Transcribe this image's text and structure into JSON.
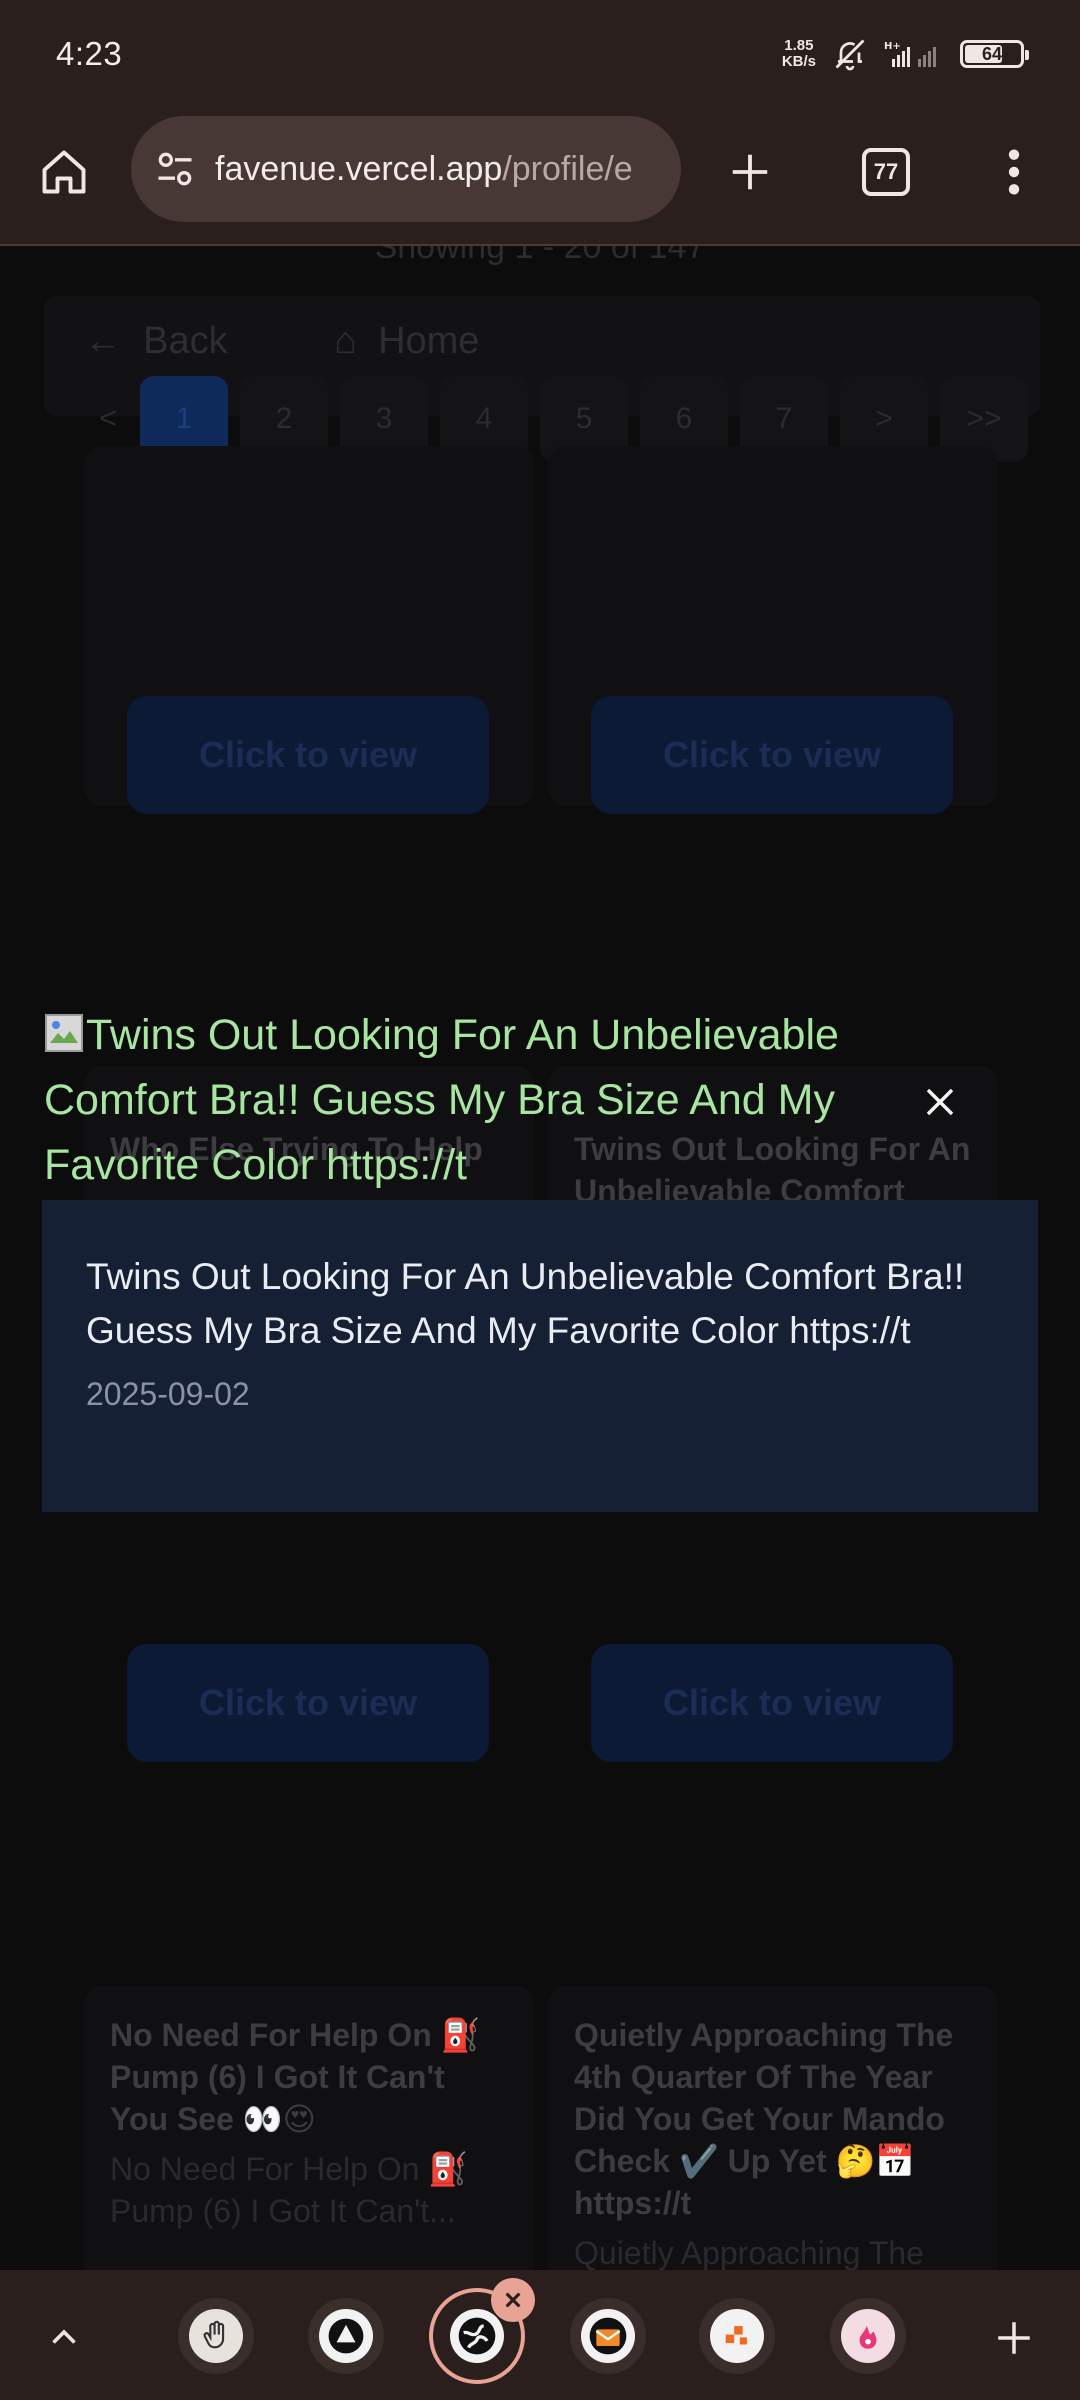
{
  "status_bar": {
    "time": "4:23",
    "net_speed_value": "1.85",
    "net_speed_unit": "KB/s",
    "battery": "64"
  },
  "browser": {
    "url_host": "favenue.vercel.app",
    "url_path": "/profile/e",
    "tab_count": "77"
  },
  "background_page": {
    "showing": "Showing 1 - 20 of 147",
    "back_label": "Back",
    "home_label": "Home",
    "pages": [
      "<",
      "1",
      "2",
      "3",
      "4",
      "5",
      "6",
      "7",
      ">",
      ">>"
    ],
    "view_button_label": "Click to view",
    "cards": [
      {
        "title": "No Need For Help On ⛽ Pump (6) I Got It Can't You See 👀😍",
        "subtitle": "No Need For Help On ⛽ Pump (6) I Got It Can't..."
      },
      {
        "title": "Quietly Approaching The 4th Quarter Of The Year Did You Get Your Mando Check ✔️ Up Yet 🤔📅 https://t",
        "subtitle": "Quietly Approaching The"
      }
    ],
    "mid_cards": [
      {
        "title": "Who Else Trying To Help"
      },
      {
        "title": "Twins Out Looking For An Unbelievable Comfort Bra!! Guess My Bra Size"
      }
    ]
  },
  "modal": {
    "image_alt": "Twins Out Looking For An Unbelievable Comfort Bra!! Guess My Bra Size And My Favorite Color https://t",
    "caption": "Twins Out Looking For An Unbelievable Comfort Bra!! Guess My Bra Size And My Favorite Color https://t",
    "date": "2025-09-02"
  },
  "colors": {
    "chrome_bg": "#2a1f1d",
    "alt_text_green": "#a7e5a0",
    "panel_bg": "#162034",
    "active_tab_ring": "#e8a395"
  },
  "bottom_tabs": [
    "hand-icon",
    "triangle-icon",
    "globe-icon",
    "mail-icon",
    "dots-icon",
    "flame-icon"
  ]
}
